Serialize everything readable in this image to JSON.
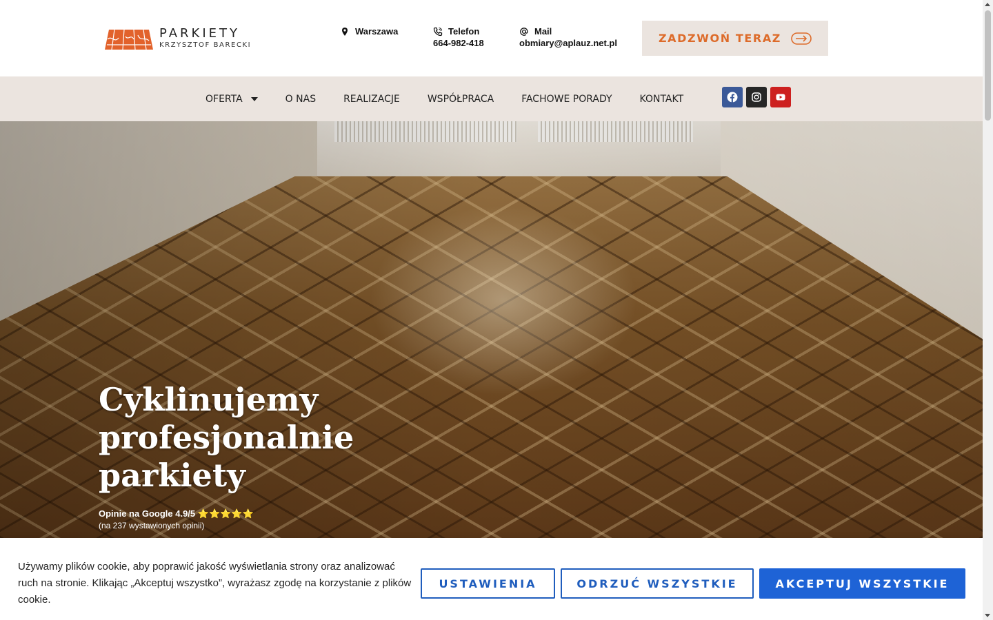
{
  "brand": {
    "title": "PARKIETY",
    "subtitle": "KRZYSZTOF BARECKI",
    "accent_color": "#dd6b2a"
  },
  "contacts": {
    "city": {
      "icon": "map-pin-icon",
      "label": "Warszawa"
    },
    "phone": {
      "icon": "phone-icon",
      "label": "Telefon",
      "value": "664-982-418"
    },
    "mail": {
      "icon": "at-sign-icon",
      "label": "Mail",
      "value": "obmiary@aplauz.net.pl"
    }
  },
  "call_button": {
    "label": "ZADZWOŃ TERAZ",
    "icon": "arrow-right-circle-icon"
  },
  "nav": {
    "items": [
      {
        "label": "OFERTA",
        "has_dropdown": true
      },
      {
        "label": "O NAS"
      },
      {
        "label": "REALIZACJE"
      },
      {
        "label": "WSPÓŁPRACA"
      },
      {
        "label": "FACHOWE PORADY"
      },
      {
        "label": "KONTAKT"
      }
    ],
    "background": "#ebe4df"
  },
  "socials": [
    {
      "name": "facebook-icon",
      "color": "#3b5998"
    },
    {
      "name": "instagram-icon",
      "color": "#262626"
    },
    {
      "name": "youtube-icon",
      "color": "#cd201f"
    }
  ],
  "hero": {
    "title": "Cyklinujemy profesjonalnie parkiety",
    "rating": "Opinie na Google 4.9/5 ⭐⭐⭐⭐⭐",
    "rating_sub": "(na 237 wystawionych opinii)"
  },
  "cookie": {
    "text": "Używamy plików cookie, aby poprawić jakość wyświetlania strony oraz analizować ruch na stronie. Klikając „Akceptuj wszystko”, wyrażasz zgodę na korzystanie z plików cookie.",
    "settings_label": "USTAWIENIA",
    "reject_label": "ODRZUĆ WSZYSTKIE",
    "accept_label": "AKCEPTUJ WSZYSTKIE",
    "accent_color": "#1e63d6"
  }
}
